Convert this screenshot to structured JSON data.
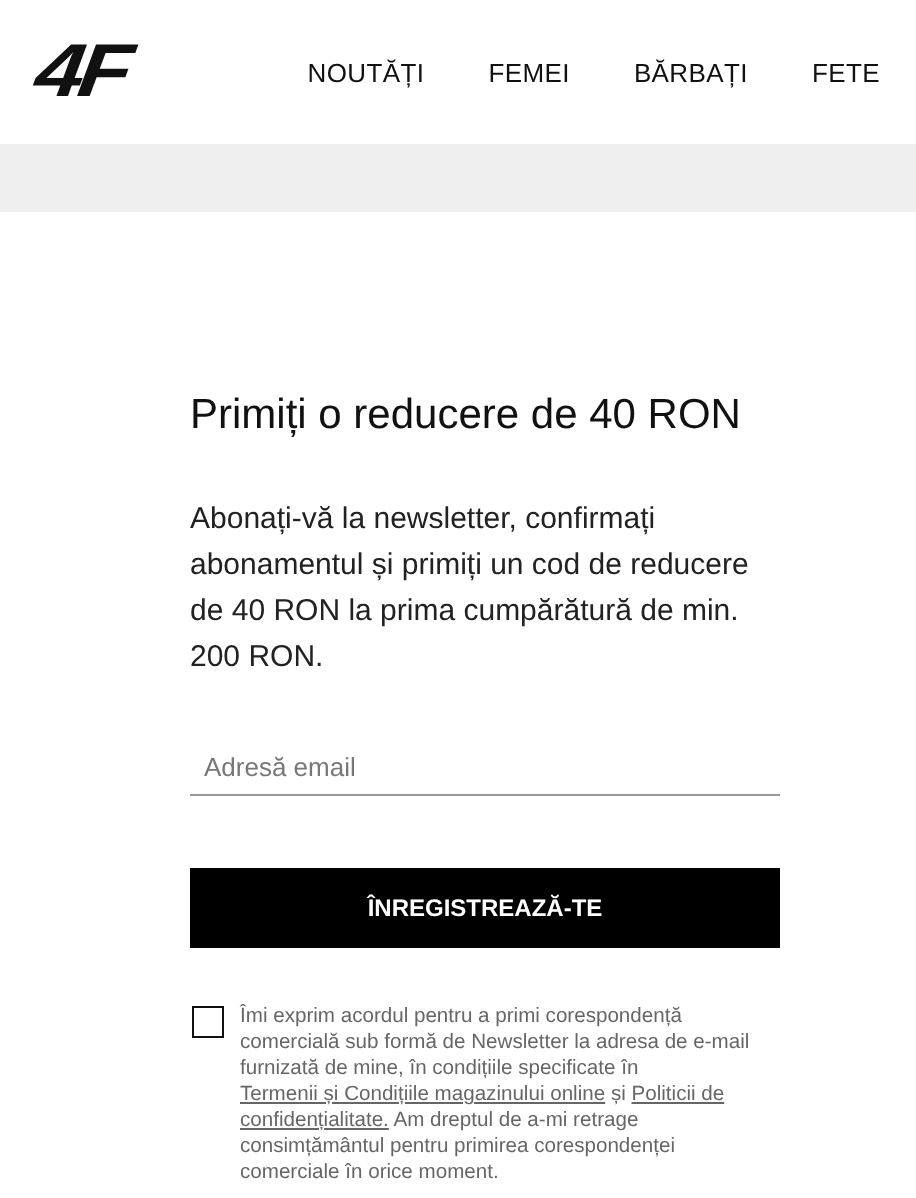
{
  "header": {
    "logo": "4F",
    "nav": [
      {
        "label": "NOUTĂȚI"
      },
      {
        "label": "FEMEI"
      },
      {
        "label": "BĂRBAȚI"
      },
      {
        "label": "FETE"
      }
    ]
  },
  "newsletter": {
    "title": "Primiți o reducere de 40 RON",
    "description": "Abonați-vă la newsletter, confirmați abonamentul și primiți un cod de reducere de 40 RON la prima cumpărătură de min. 200 RON.",
    "email": {
      "placeholder": "Adresă email"
    },
    "button": "ÎNREGISTREAZĂ-TE",
    "consent": {
      "checked": false,
      "parts": [
        {
          "kind": "text",
          "text": "Îmi exprim acordul pentru a primi corespondență comercială sub formă de Newsletter la adresa de e-mail furnizată de mine, în condițiile specificate în "
        },
        {
          "kind": "link",
          "text": "Termenii și Condițiile magazinului online"
        },
        {
          "kind": "text",
          "text": " și "
        },
        {
          "kind": "link",
          "text": "Politicii de"
        },
        {
          "kind": "link",
          "text": "confidențialitate."
        },
        {
          "kind": "text",
          "text": " Am dreptul de a-mi retrage consimțământul pentru primirea corespondenței comerciale în orice moment."
        }
      ]
    }
  }
}
